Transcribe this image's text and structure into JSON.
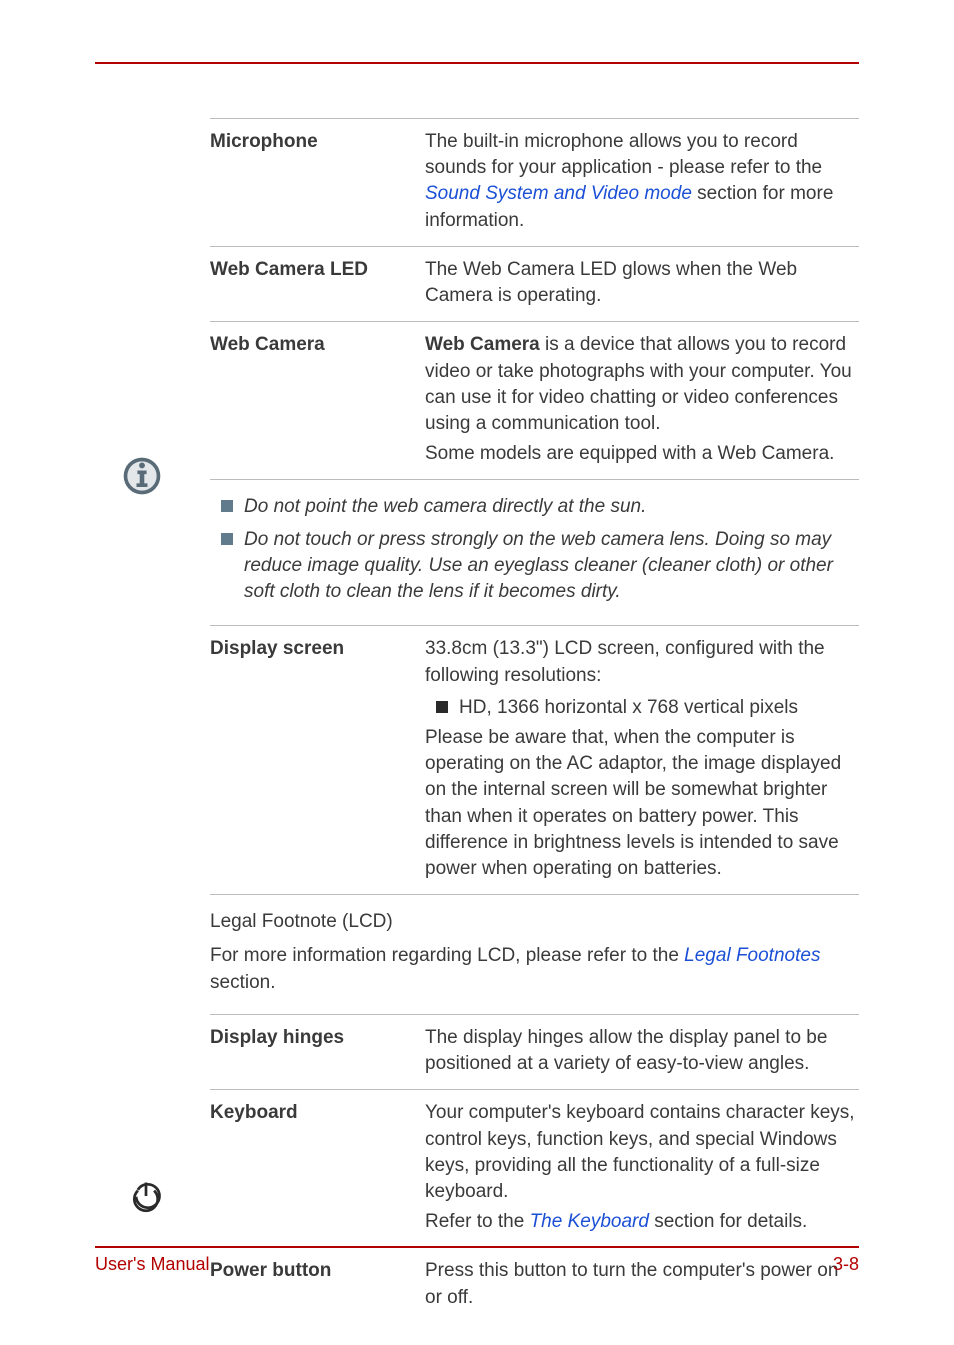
{
  "rows": {
    "microphone": {
      "label": "Microphone",
      "text_a": "The built-in microphone allows you to record sounds for your application - please refer to the ",
      "link": "Sound System and Video mode",
      "text_b": " section for more information."
    },
    "web_camera_led": {
      "label": "Web Camera LED",
      "text": "The Web Camera LED glows when the Web Camera is operating."
    },
    "web_camera": {
      "label": "Web Camera",
      "bold_lead": "Web Camera",
      "text_a": " is a device that allows you to record video or take photographs with your computer. You can use it for video chatting or video conferences using a communication tool.",
      "text_b": "Some models are equipped with a Web Camera."
    },
    "display_screen": {
      "label": "Display screen",
      "intro": "33.8cm (13.3\") LCD screen, configured with the following resolutions:",
      "bullet": "HD, 1366 horizontal x 768 vertical pixels",
      "para": "Please be aware that, when the computer is operating on the AC adaptor, the image displayed on the internal screen will be somewhat brighter than when it operates on battery power. This difference in brightness levels is intended to save power when operating on batteries."
    },
    "display_hinges": {
      "label": "Display hinges",
      "text": "The display hinges allow the display panel to be positioned at a variety of easy-to-view angles."
    },
    "keyboard": {
      "label": "Keyboard",
      "text_a": "Your computer's keyboard contains character keys, control keys, function keys, and special Windows keys, providing all the functionality of a full-size keyboard.",
      "text_b_pre": "Refer to the ",
      "text_b_link": "The Keyboard",
      "text_b_post": " section for details."
    },
    "power_button": {
      "label": "Power button",
      "text": "Press this button to turn the computer's power on or off."
    }
  },
  "callout": {
    "item1": "Do not point the web camera directly at the sun.",
    "item2": "Do not touch or press strongly on the web camera lens. Doing so may reduce image quality. Use an eyeglass cleaner (cleaner cloth) or other soft cloth to clean the lens if it becomes dirty."
  },
  "legal": {
    "heading": "Legal Footnote (LCD)",
    "text_pre": "For more information regarding LCD, please refer to the ",
    "link": "Legal Footnotes",
    "text_post": " section."
  },
  "footer": {
    "left": "User's Manual",
    "right": "3-8"
  }
}
